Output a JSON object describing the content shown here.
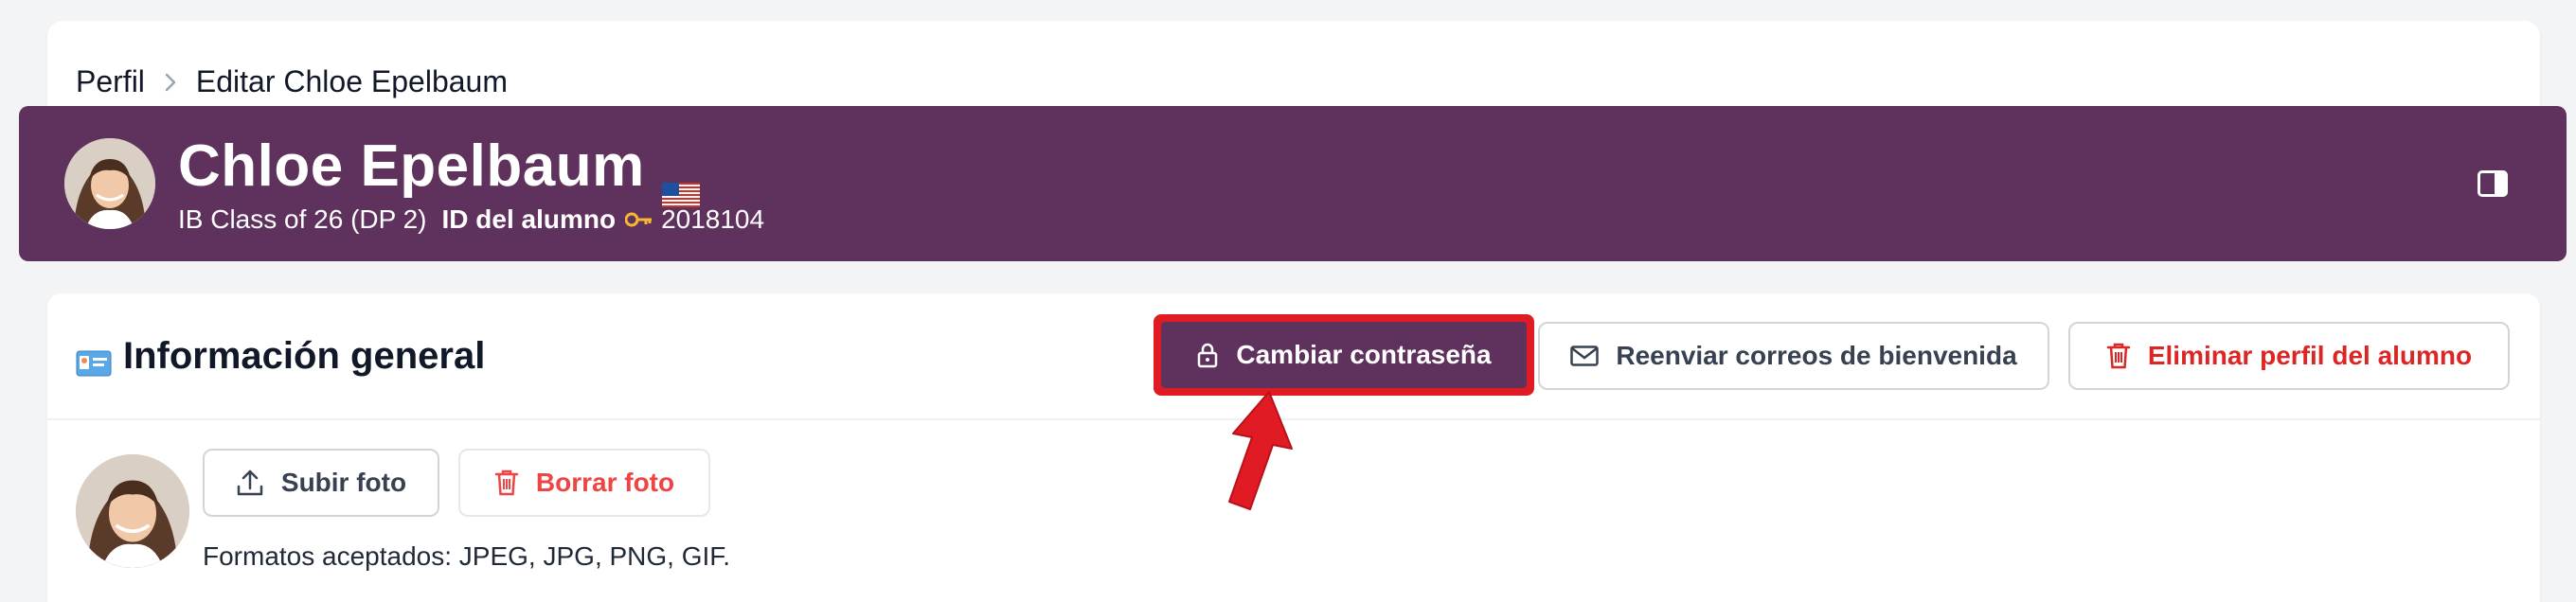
{
  "breadcrumb": {
    "root": "Perfil",
    "current": "Editar Chloe Epelbaum"
  },
  "header": {
    "name": "Chloe Epelbaum",
    "flag_icon": "us-flag-icon",
    "class_text": "IB Class of 26 (DP 2)",
    "student_id_label": "ID del alumno",
    "student_id_value": "2018104",
    "background_color": "#5f325e"
  },
  "general_info": {
    "title": "Información general",
    "change_password_label": "Cambiar contraseña",
    "resend_emails_label": "Reenviar correos de bienvenida",
    "delete_profile_label": "Eliminar perfil del alumno"
  },
  "photo": {
    "upload_label": "Subir foto",
    "delete_label": "Borrar foto",
    "formats_text": "Formatos aceptados: JPEG, JPG, PNG, GIF."
  },
  "colors": {
    "brand_purple": "#5f325e",
    "highlight_red": "#e01b24",
    "danger_red": "#dc2626"
  }
}
